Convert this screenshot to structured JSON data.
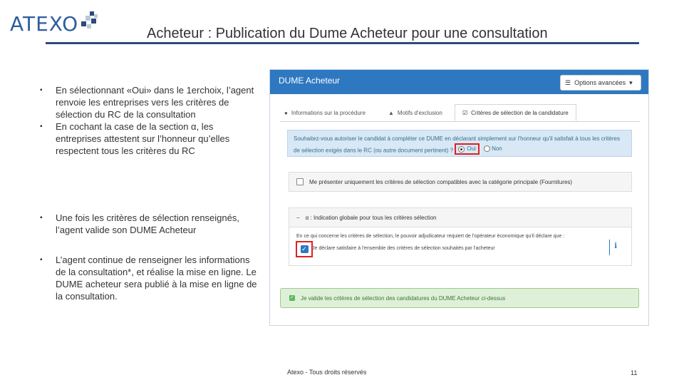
{
  "logo": {
    "text": "ATEXO",
    "colors": {
      "primary": "#2e5d9e",
      "square_dark": "#2e4a7d",
      "square_light": "#b9c9dc"
    }
  },
  "title": "Acheteur : Publication du Dume Acheteur pour une consultation",
  "bullets": [
    "En sélectionnant «Oui» dans le 1erchoix, l’agent renvoie les entreprises vers les critères de sélection du RC de la consultation",
    "En cochant la case de la section α, les entreprises attestent sur l’honneur qu’elles respectent tous les critères du RC",
    "Une fois les critères de sélection renseignés, l’agent valide son DUME Acheteur",
    "L’agent continue de renseigner les informations de la consultation*, et réalise la mise en ligne. Le DUME acheteur sera publié à la mise en ligne de la consultation."
  ],
  "app": {
    "header_title": "DUME Acheteur",
    "options_button": "Options avancées",
    "options_icon": "list-icon",
    "tabs": [
      {
        "label": "Informations sur la procédure",
        "icon": "info-circle-icon"
      },
      {
        "label": "Motifs d'exclusion",
        "icon": "warning-icon"
      },
      {
        "label": "Critères de sélection de la candidature",
        "icon": "checkbox-icon"
      }
    ],
    "question": {
      "text": "Souhaitez-vous autoriser le candidat à compléter ce DUME en déclarant simplement sur l'honneur qu'il satisfait à tous les critères de sélection exigés dans le RC (ou autre document pertinent) ?",
      "oui": "Oui",
      "non": "Non"
    },
    "panel_categorie": "Me présenter uniquement les critères de sélection compatibles avec la catégorie principale (Fournitures)",
    "panel_alpha": {
      "toggle": "−",
      "title": "α : Indication globale pour tous les critères sélection",
      "line1": "En ce qui concerne les critères de sélection, le pouvoir adjudicateur requiert de l'opérateur économique qu'il déclare que :",
      "line2": "Je déclare satisfaire à l'ensemble des critères de sélection souhaités par l'acheteur",
      "info": "i"
    },
    "validate_label": "Je valide les critères de sélection des candidatures du DUME Acheteur ci-dessus",
    "colors": {
      "header": "#2e78c1",
      "question_bg": "#d9e8f5",
      "validate_bg": "#dff0d8",
      "highlight": "#e02020"
    }
  },
  "footer": "Atexo - Tous droits réservés",
  "page_number": "11"
}
